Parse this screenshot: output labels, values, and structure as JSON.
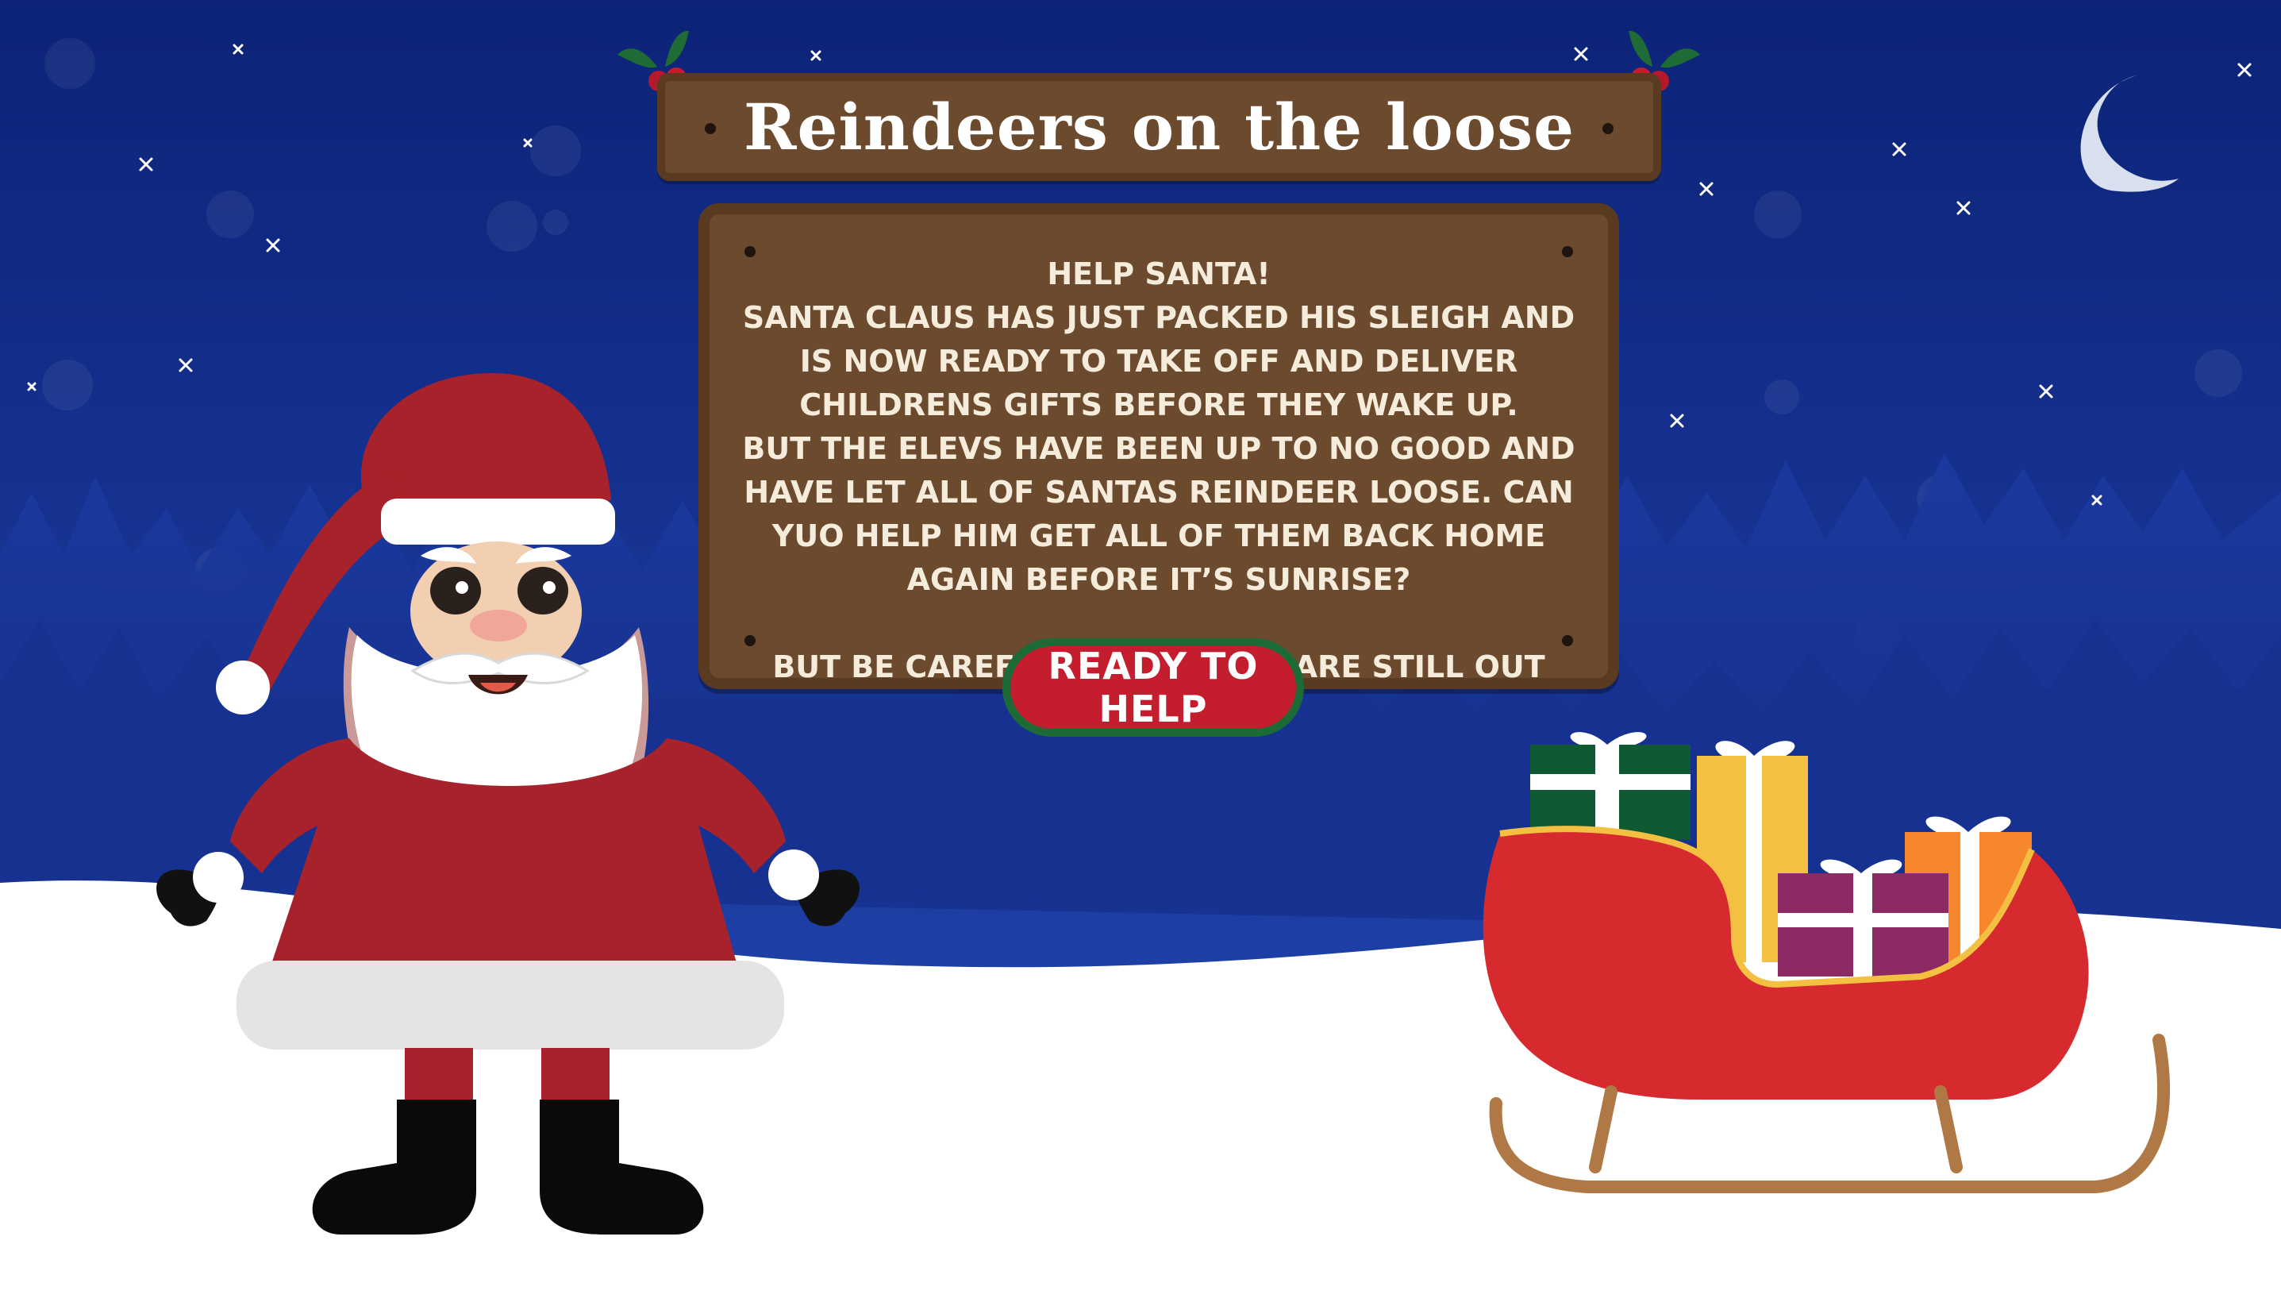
{
  "title": "Reindeers on the loose",
  "story": {
    "lines_1": "HELP SANTA!",
    "lines_2": "SANTA CLAUS HAS JUST PACKED HIS SLEIGH AND IS NOW READY TO TAKE OFF AND DELIVER CHILDRENS GIFTS BEFORE THEY WAKE UP.",
    "lines_3": "BUT THE ELEVS HAVE BEEN UP TO NO GOOD AND HAVE LET ALL OF SANTAS REINDEER LOOSE. CAN YUO HELP HIM GET ALL OF THEM BACK HOME AGAIN BEFORE IT’S SUNRISE?",
    "lines_4": "BUT BE CAREFUL, THE ELEVES ARE STILL OUT THERE!"
  },
  "button": {
    "label": "READY TO HELP"
  },
  "icons": [
    "holly-icon",
    "moon-icon",
    "star-icon",
    "santa-hat-icon"
  ],
  "colors": {
    "sky_top": "#0d2a7a",
    "sky_bottom": "#1f3fa8",
    "board": "#6b4a2e",
    "board_border": "#5a3b22",
    "button_red": "#c41e2e",
    "button_green": "#1c6b37",
    "snow": "#ffffff"
  }
}
